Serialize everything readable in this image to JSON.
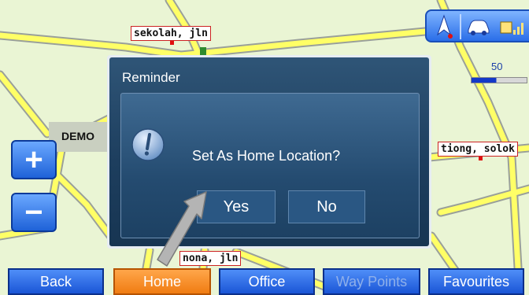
{
  "map": {
    "demo_label": "DEMO",
    "streets": [
      {
        "name": "sekolah, jln"
      },
      {
        "name": "tiong, solok"
      },
      {
        "name": "nona, jln"
      }
    ],
    "scale_label": "50",
    "colors": {
      "background": "#eaf5d4",
      "road_fill": "#ffff66",
      "road_edge": "#9aa09a",
      "label_border": "#cc2222"
    }
  },
  "zoom": {
    "in_label": "+",
    "out_label": "−"
  },
  "status": {
    "north_icon": "north-arrow-icon",
    "car_icon": "car-icon",
    "signal_icon": "gps-signal-icon"
  },
  "dialog": {
    "title": "Reminder",
    "message": "Set As Home Location?",
    "yes_label": "Yes",
    "no_label": "No",
    "icon": "info-icon"
  },
  "toolbar": {
    "back_label": "Back",
    "home_label": "Home",
    "office_label": "Office",
    "waypoints_label": "Way Points",
    "favourites_label": "Favourites"
  },
  "colors": {
    "accent_blue": "#1f62d8",
    "active_orange": "#f07c12",
    "dialog_bg": "#1d3e5e"
  }
}
